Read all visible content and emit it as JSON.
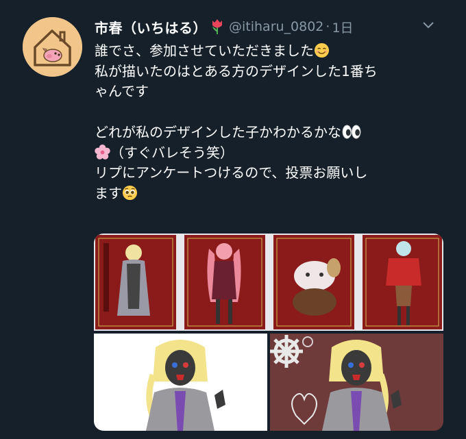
{
  "tweet": {
    "display_name": "市春（いちはる）",
    "handle": "@itiharu_0802",
    "separator": "·",
    "time": "1日",
    "lines": [
      "誰でさ、参加させていただきました",
      "私が描いたのはとある方のデザインした1番ち",
      "ゃんです",
      "",
      "どれが私のデザインした子かわかるかな",
      "（すぐバレそう笑）",
      "リプにアンケートつけるので、投票お願いし",
      "ます"
    ]
  },
  "icons": {
    "avatar": "avatar-pig-house",
    "name_emoji": "tulip-icon",
    "menu": "chevron-down-icon",
    "line1_emoji": "smiling-face-icon",
    "line5_emoji": "eyes-icon",
    "line6_emoji": "cherry-blossom-icon",
    "line8_emoji": "pleading-face-icon"
  },
  "colors": {
    "background": "#15202b",
    "text": "#ffffff",
    "secondary": "#8899a6",
    "card_red": "#8b1a1a",
    "avatar_bg": "#f2c68a"
  }
}
